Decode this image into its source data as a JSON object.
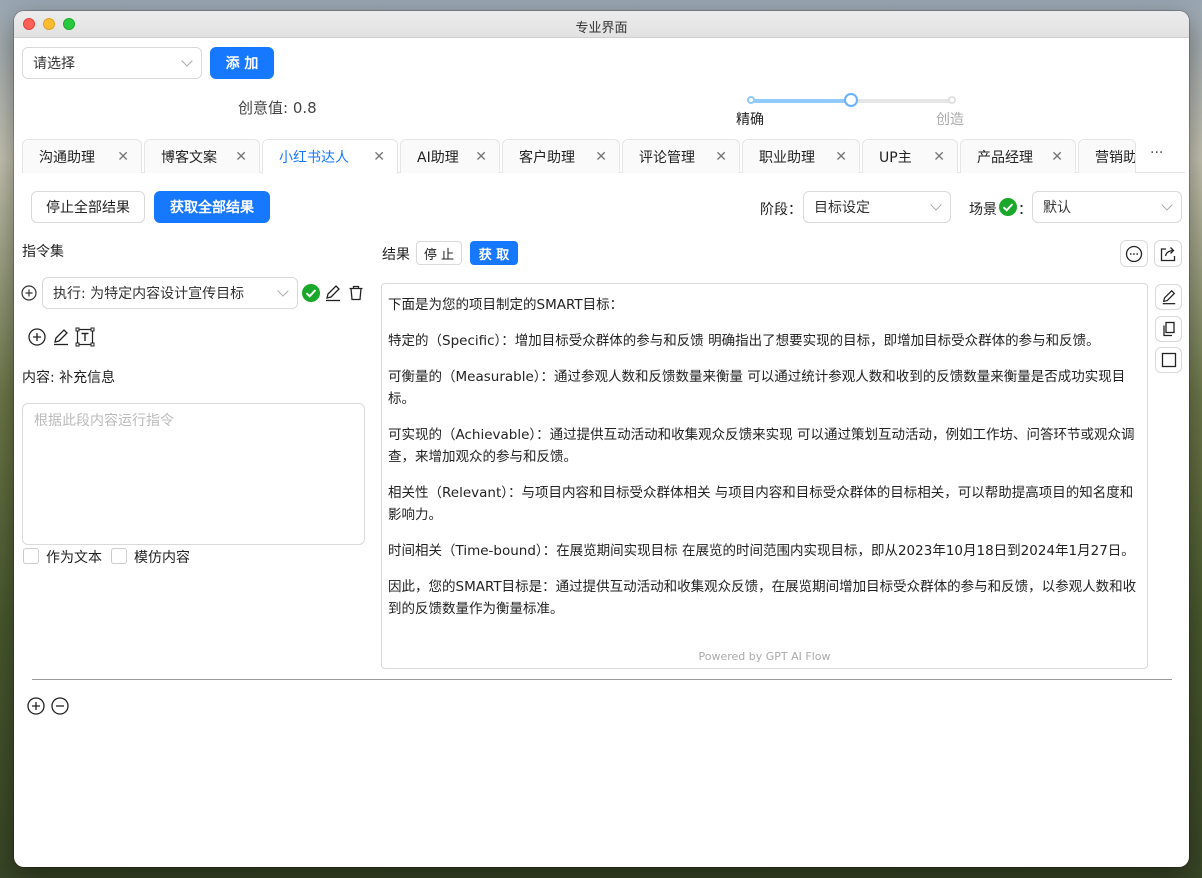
{
  "window": {
    "title": "专业界面"
  },
  "top": {
    "select_placeholder": "请选择",
    "add_label": "添 加",
    "creativity_label": "创意值: 0.8",
    "creativity_value": 0.8,
    "slider_left_label": "精确",
    "slider_right_label": "创造"
  },
  "tabs": [
    {
      "label": "沟通助理"
    },
    {
      "label": "博客文案"
    },
    {
      "label": "小红书达人",
      "active": true
    },
    {
      "label": "AI助理"
    },
    {
      "label": "客户助理"
    },
    {
      "label": "评论管理"
    },
    {
      "label": "职业助理"
    },
    {
      "label": "UP主"
    },
    {
      "label": "产品经理"
    },
    {
      "label": "营销助"
    }
  ],
  "tabs_more": "···",
  "toolbar": {
    "stop_all": "停止全部结果",
    "get_all": "获取全部结果",
    "stage_label": "阶段：",
    "stage_value": "目标设定",
    "scene_label": "场景",
    "scene_colon": "：",
    "scene_value": "默认"
  },
  "left": {
    "instructions_title": "指令集",
    "exec_value": "执行: 为特定内容设计宣传目标",
    "content_label": "内容: 补充信息",
    "textarea_placeholder": "根据此段内容运行指令",
    "as_text": "作为文本",
    "imitate": "模仿内容"
  },
  "result": {
    "label": "结果",
    "stop": "停 止",
    "get": "获 取",
    "paragraphs": [
      "下面是为您的项目制定的SMART目标：",
      "特定的（Specific）：增加目标受众群体的参与和反馈 明确指出了想要实现的目标，即增加目标受众群体的参与和反馈。",
      "可衡量的（Measurable）：通过参观人数和反馈数量来衡量 可以通过统计参观人数和收到的反馈数量来衡量是否成功实现目标。",
      "可实现的（Achievable）：通过提供互动活动和收集观众反馈来实现 可以通过策划互动活动，例如工作坊、问答环节或观众调查，来增加观众的参与和反馈。",
      "相关性（Relevant）：与项目内容和目标受众群体相关 与项目内容和目标受众群体的目标相关，可以帮助提高项目的知名度和影响力。",
      "时间相关（Time-bound）：在展览期间实现目标 在展览的时间范围内实现目标，即从2023年10月18日到2024年1月27日。",
      "因此，您的SMART目标是：通过提供互动活动和收集观众反馈，在展览期间增加目标受众群体的参与和反馈，以参观人数和收到的反馈数量作为衡量标准。"
    ],
    "powered": "Powered by GPT AI Flow"
  },
  "colors": {
    "accent": "#1677ff",
    "success": "#1aa82a"
  }
}
